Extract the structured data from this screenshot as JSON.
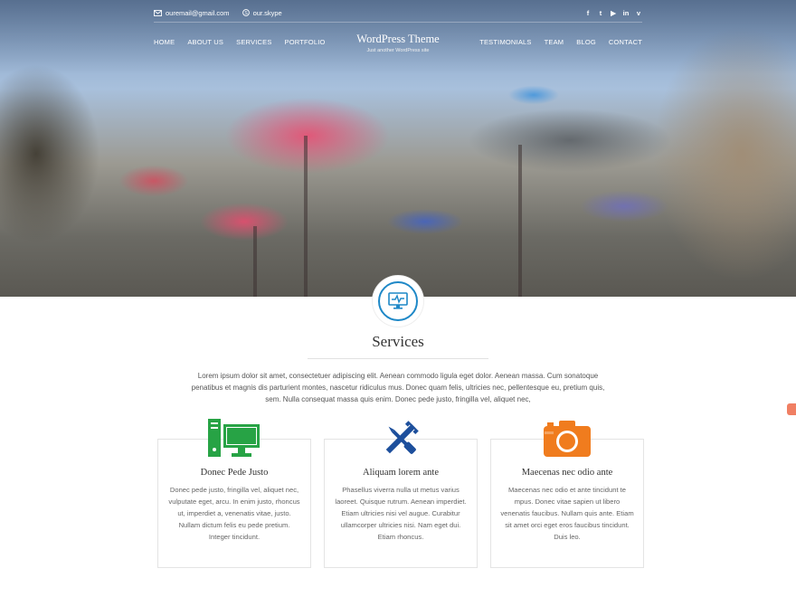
{
  "contact": {
    "email": "ouremail@gmail.com",
    "skype": "our.skype"
  },
  "social": [
    {
      "icon": "facebook-icon",
      "glyph": "f"
    },
    {
      "icon": "twitter-icon",
      "glyph": "t"
    },
    {
      "icon": "youtube-icon",
      "glyph": "▶"
    },
    {
      "icon": "linkedin-icon",
      "glyph": "in"
    },
    {
      "icon": "vimeo-icon",
      "glyph": "v"
    }
  ],
  "nav": {
    "left": [
      "HOME",
      "ABOUT US",
      "SERVICES",
      "PORTFOLIO"
    ],
    "right": [
      "TESTIMONIALS",
      "TEAM",
      "BLOG",
      "CONTACT"
    ]
  },
  "brand": {
    "title": "WordPress Theme",
    "tagline": "Just another WordPress site"
  },
  "services": {
    "badge_icon": "monitor-icon",
    "title": "Services",
    "description": "Lorem ipsum dolor sit amet, consectetuer adipiscing elit. Aenean commodo ligula eget dolor. Aenean massa. Cum sonatoque penatibus et magnis dis parturient montes, nascetur ridiculus mus. Donec quam felis, ultricies nec, pellentesque eu, pretium quis, sem. Nulla consequat massa quis enim. Donec pede justo, fringilla vel, aliquet nec,",
    "cards": [
      {
        "icon": "computer-icon",
        "color": "#27a345",
        "title": "Donec Pede Justo",
        "text": "Donec pede justo, fringilla vel, aliquet nec, vulputate eget, arcu. In enim justo, rhoncus ut, imperdiet a, venenatis vitae, justo. Nullam dictum felis eu pede pretium. Integer tincidunt."
      },
      {
        "icon": "tools-icon",
        "color": "#1d4f9c",
        "title": "Aliquam lorem ante",
        "text": "Phasellus viverra nulla ut metus varius laoreet. Quisque rutrum. Aenean imperdiet. Etiam ultricies nisi vel augue. Curabitur ullamcorper ultricies nisi. Nam eget dui. Etiam rhoncus."
      },
      {
        "icon": "camera-icon",
        "color": "#f07c1e",
        "title": "Maecenas nec odio ante",
        "text": "Maecenas nec odio et ante tincidunt te mpus. Donec vitae sapien ut libero venenatis faucibus. Nullam quis ante. Etiam sit amet orci eget eros faucibus tincidunt. Duis leo."
      }
    ]
  },
  "accent_color": "#1e88c7",
  "side_tab_color": "#f07f63"
}
